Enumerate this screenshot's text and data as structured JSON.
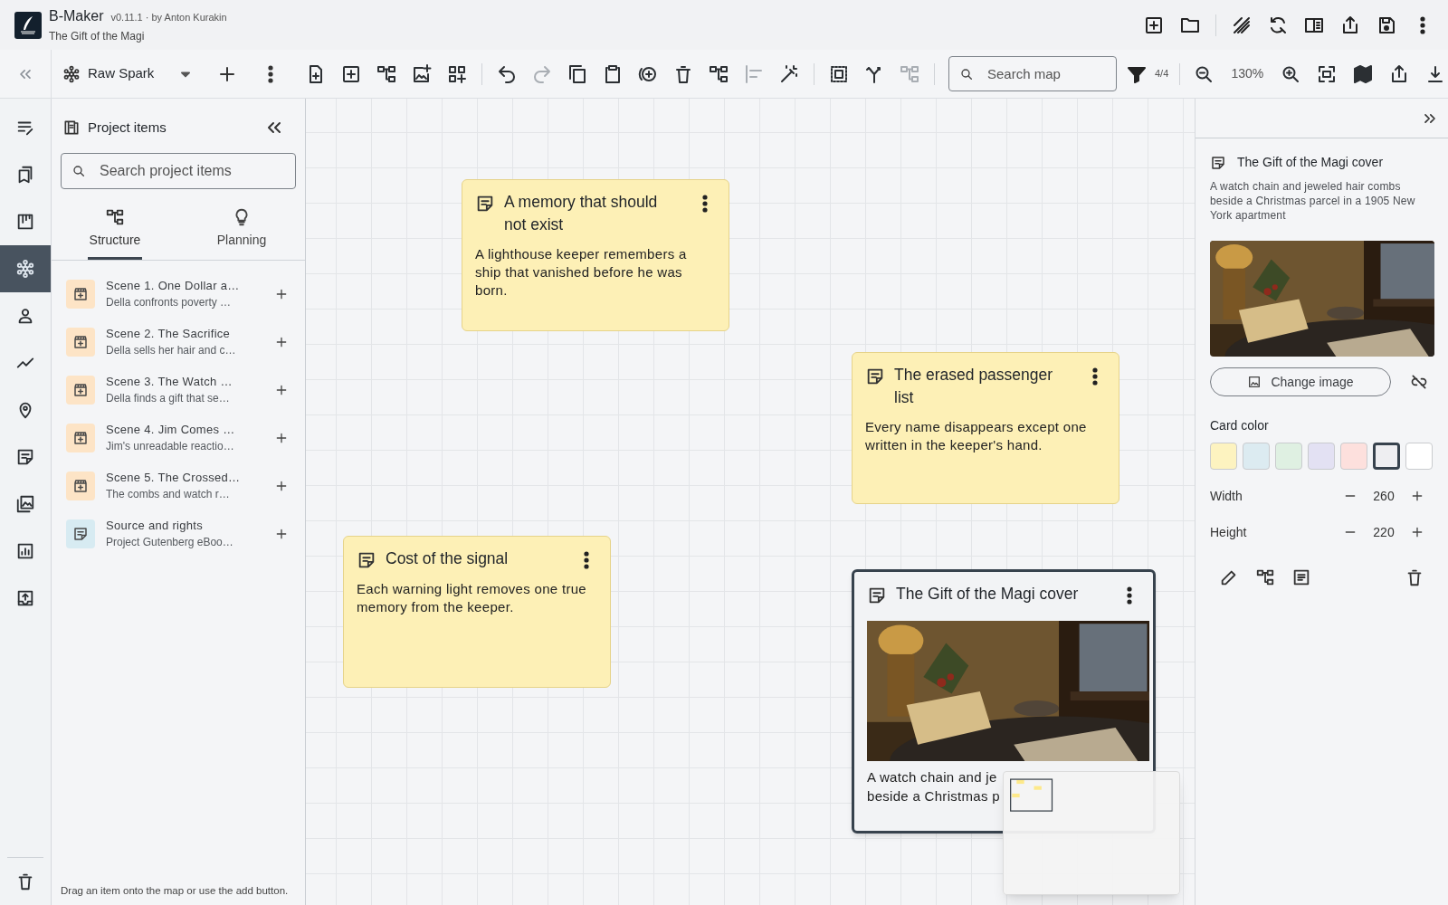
{
  "app": {
    "name": "B-Maker",
    "version": "v0.11.1 · by Anton Kurakin",
    "project": "The Gift of the Magi"
  },
  "toolbar": {
    "map_name": "Raw Spark",
    "tools": [
      {
        "disabled": false
      },
      {
        "disabled": false
      },
      {
        "disabled": false
      },
      {
        "disabled": false
      },
      {
        "disabled": false
      },
      {
        "disabled": false
      },
      {
        "disabled": true
      },
      {
        "disabled": false
      },
      {
        "disabled": false
      },
      {
        "disabled": false
      },
      {
        "disabled": false
      },
      {
        "disabled": false
      },
      {
        "disabled": true
      },
      {
        "disabled": false
      },
      {
        "disabled": false
      },
      {
        "disabled": false
      },
      {
        "disabled": true
      }
    ],
    "search": {
      "placeholder": "Search map"
    },
    "filter_count": "4/4",
    "zoom": "130%"
  },
  "rail": [
    {
      "selected": false
    },
    {
      "selected": false
    },
    {
      "selected": false
    },
    {
      "selected": true
    },
    {
      "selected": false
    },
    {
      "selected": false
    },
    {
      "selected": false
    },
    {
      "selected": false
    },
    {
      "selected": false
    },
    {
      "selected": false
    },
    {
      "selected": false
    }
  ],
  "project_panel": {
    "title": "Project items",
    "search": {
      "placeholder": "Search project items"
    },
    "tabs": [
      {
        "label": "Structure",
        "selected": true
      },
      {
        "label": "Planning",
        "selected": false
      }
    ],
    "items": [
      {
        "kind": "scene",
        "title": "Scene 1. One Dollar a…",
        "subtitle": "Della confronts poverty …"
      },
      {
        "kind": "scene",
        "title": "Scene 2. The Sacrifice",
        "subtitle": "Della sells her hair and c…"
      },
      {
        "kind": "scene",
        "title": "Scene 3. The Watch …",
        "subtitle": "Della finds a gift that se…"
      },
      {
        "kind": "scene",
        "title": "Scene 4. Jim Comes …",
        "subtitle": "Jim's unreadable reactio…"
      },
      {
        "kind": "scene",
        "title": "Scene 5. The Crossed…",
        "subtitle": "The combs and watch r…"
      },
      {
        "kind": "note",
        "title": "Source and rights",
        "subtitle": "Project Gutenberg eBoo…"
      }
    ],
    "hint": "Drag an item onto the map or use the add button."
  },
  "cards": [
    {
      "title": "A memory that should not exist",
      "text_lines": [
        "A lighthouse keeper remembers a ship that vanished before he was born."
      ],
      "color": "#fdf0b6",
      "selected": false
    },
    {
      "title": "The erased passenger list",
      "text_lines": [
        "Every name disappears except one written in the keeper's hand."
      ],
      "color": "#fdf0b6",
      "selected": false
    },
    {
      "title": "Cost of the signal",
      "text_lines": [
        "Each warning light removes one true memory from the keeper."
      ],
      "color": "#fdf0b6",
      "selected": false
    },
    {
      "title": "The Gift of the Magi cover",
      "text_lines": [
        "A watch chain and je",
        "beside a Christmas p"
      ],
      "color": "#f2f3f5",
      "selected": true
    }
  ],
  "inspector": {
    "title": "The Gift of the Magi cover",
    "description": "A watch chain and jeweled hair combs beside a Christmas parcel in a 1905 New York apartment",
    "change_image": "Change image",
    "card_color_label": "Card color",
    "swatches": [
      {
        "color": "#fdf3c0",
        "selected": false
      },
      {
        "color": "#dcebf1",
        "selected": false
      },
      {
        "color": "#dff0e2",
        "selected": false
      },
      {
        "color": "#e3e1f3",
        "selected": false
      },
      {
        "color": "#fde0dd",
        "selected": false
      },
      {
        "color": "#eeeef1",
        "selected": true
      },
      {
        "color": "#ffffff",
        "selected": false
      }
    ],
    "width": {
      "label": "Width",
      "value": "260"
    },
    "height": {
      "label": "Height",
      "value": "220"
    }
  }
}
